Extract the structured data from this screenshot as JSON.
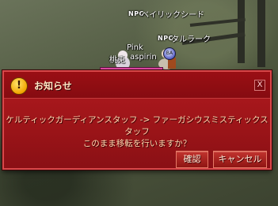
{
  "scene": {
    "npc_badge": "NPC",
    "npc1_name": "ベイリックシード",
    "npc2_name": "タルラーク",
    "guild_badge_text": "BA",
    "player_pet_name": "Pink",
    "player_label": "桃兎",
    "player_name": "aspirin"
  },
  "dialog": {
    "title": "お知らせ",
    "warning_icon": "!",
    "close_label": "X",
    "message": "ケルティックガーディアンスタッフ -> ファーガシウスミスティックスタッフ\nこのまま移転を行いますか？",
    "ok_label": "確認",
    "cancel_label": "キャンセル"
  },
  "colors": {
    "dialog_bg": "#9b1418",
    "dialog_border": "#d8484a",
    "message_text": "#ffd9b0",
    "hp_bar": "#e24aa5"
  }
}
